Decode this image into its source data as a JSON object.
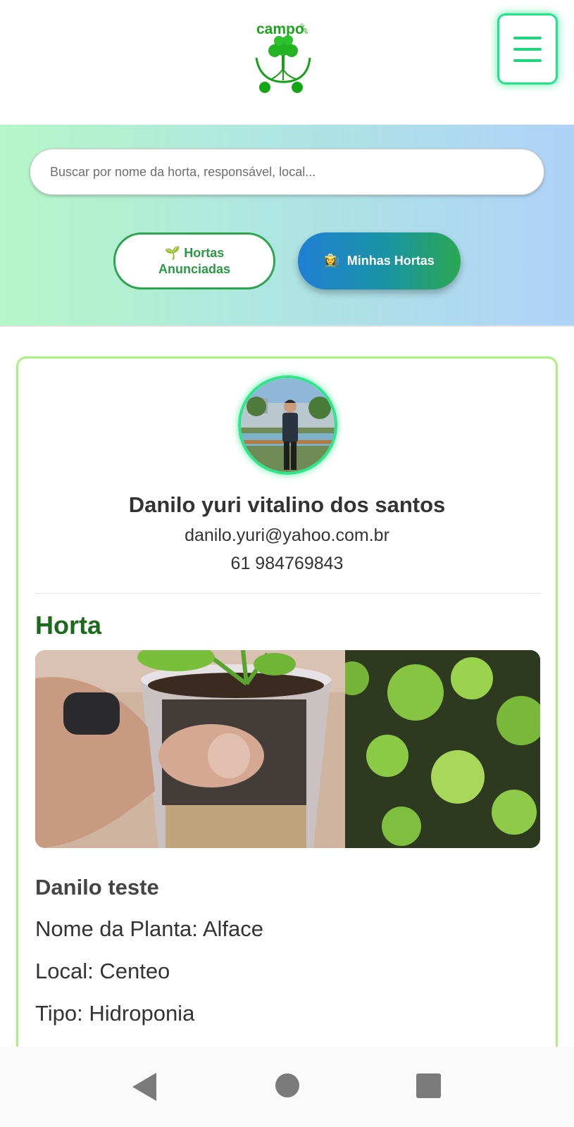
{
  "header": {
    "logo_text": "campo",
    "logo_small_text": "clube",
    "menu_icon": "hamburger-icon"
  },
  "search": {
    "placeholder": "Buscar por nome da horta, responsável, local..."
  },
  "tabs": [
    {
      "emoji": "🌱",
      "label": "Hortas Anunciadas"
    },
    {
      "emoji": "👩‍🌾",
      "label": "Minhas Hortas"
    }
  ],
  "profile": {
    "name": "Danilo yuri vitalino dos santos",
    "email": "danilo.yuri@yahoo.com.br",
    "phone": "61 984769843"
  },
  "garden": {
    "section_title": "Horta",
    "title": "Danilo teste",
    "plant_line": "Nome da Planta: Alface",
    "local_line": "Local: Centeo",
    "type_line": "Tipo: Hidroponia"
  },
  "colors": {
    "accent_green": "#22e38a",
    "title_green": "#1b6b1b",
    "card_border": "#a9f27d",
    "button_outline": "#2ea44f"
  },
  "system_nav": {
    "back_icon": "back-triangle-icon",
    "home_icon": "home-circle-icon",
    "recent_icon": "recent-square-icon"
  }
}
